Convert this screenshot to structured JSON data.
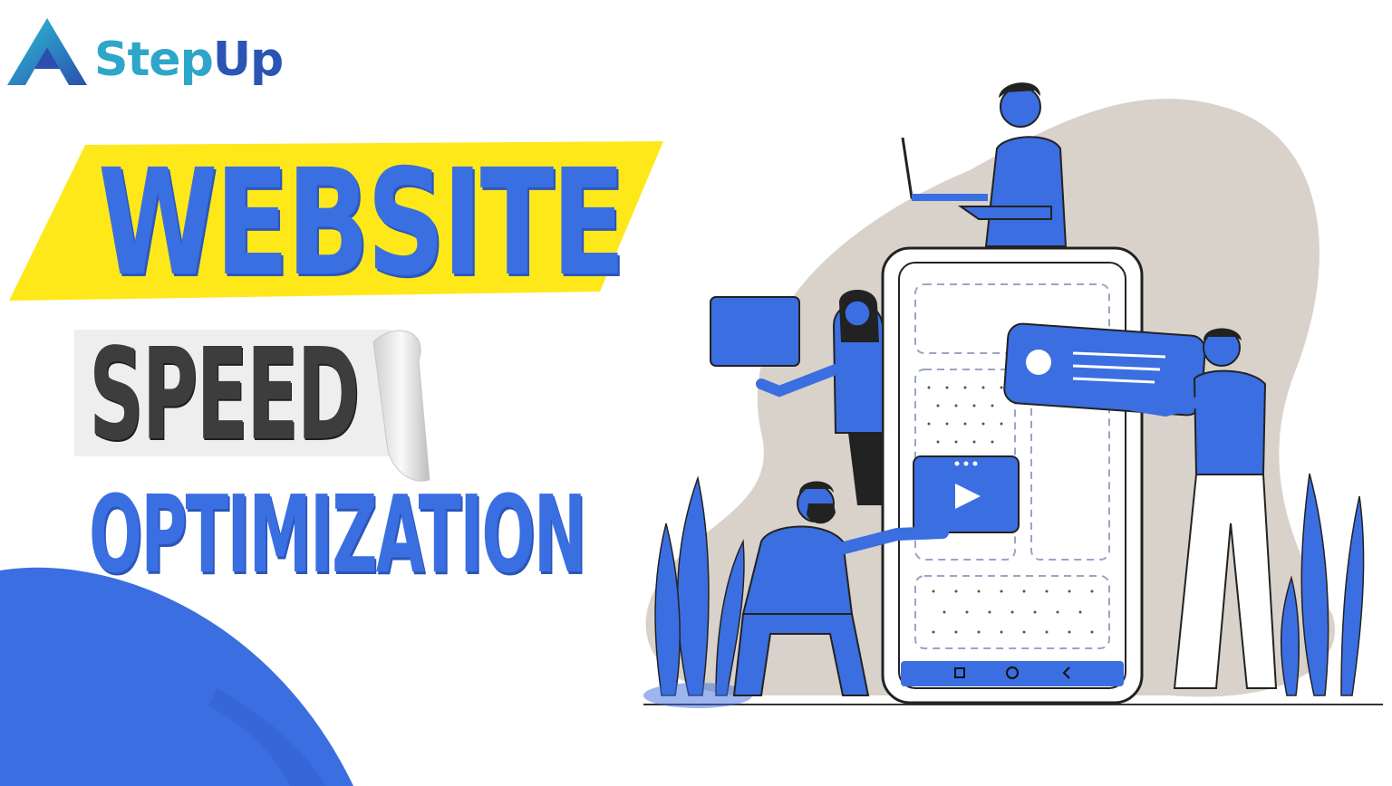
{
  "brand": {
    "name_part1": "Step",
    "name_part2": "Up"
  },
  "headline": {
    "line1": "WEBSITE",
    "line2": "SPEED",
    "line3": "OPTIMIZATION"
  },
  "colors": {
    "brand_blue": "#3a6fe2",
    "brand_teal": "#2ea6c9",
    "highlight_yellow": "#ffe81a",
    "dark_text": "#3d3d3d",
    "blob_beige": "#d9d2cb"
  },
  "icons": [
    "logo-a-icon",
    "play-icon",
    "square-nav-icon",
    "circle-nav-icon",
    "back-nav-icon"
  ]
}
